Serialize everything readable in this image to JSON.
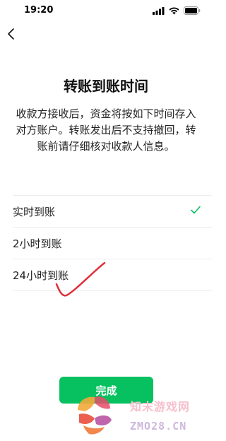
{
  "status_bar": {
    "time": "19:20",
    "icons": [
      "signal-icon",
      "wifi-icon",
      "battery-icon"
    ]
  },
  "nav": {
    "back_icon": "chevron-left-icon"
  },
  "page": {
    "title": "转账到账时间",
    "description": "收款方接收后，资金将按如下时间存入对方账户。转账发出后不支持撤回，转账前请仔细核对收款人信息。"
  },
  "options": [
    {
      "label": "实时到账",
      "selected": true
    },
    {
      "label": "2小时到账",
      "selected": false
    },
    {
      "label": "24小时到账",
      "selected": false
    }
  ],
  "done_button": {
    "label": "完成"
  },
  "watermark": {
    "cn": "知末游戏网",
    "en": "ZMO28.CN"
  },
  "colors": {
    "accent": "#07c160",
    "annotation": "#e0303a"
  }
}
